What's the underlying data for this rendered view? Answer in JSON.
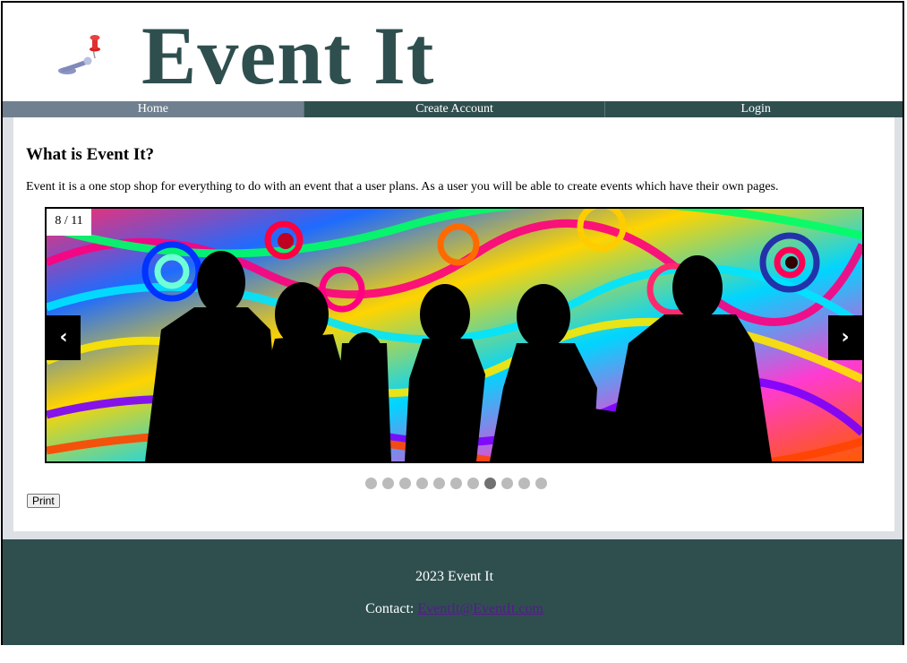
{
  "site": {
    "title": "Event It"
  },
  "nav": {
    "items": [
      {
        "label": "Home",
        "active": true
      },
      {
        "label": "Create Account",
        "active": false
      },
      {
        "label": "Login",
        "active": false
      }
    ]
  },
  "main": {
    "heading": "What is Event It?",
    "intro": "Event it is a one stop shop for everything to do with an event that a user plans. As a user you will be able to create events which have their own pages."
  },
  "slideshow": {
    "counter": "8 / 11",
    "current": 8,
    "total": 11,
    "prev_icon": "‹",
    "next_icon": "›"
  },
  "print_button": {
    "label": "Print"
  },
  "footer": {
    "copyright": "2023 Event It",
    "contact_label": "Contact:",
    "contact_email": "EventIt@EventIt.com"
  },
  "colors": {
    "brand": "#2f4f4f",
    "nav_active": "#708090",
    "main_bg": "#dde1e6",
    "dot": "#bbbbbb",
    "dot_active": "#717171",
    "link": "#551a8b"
  }
}
